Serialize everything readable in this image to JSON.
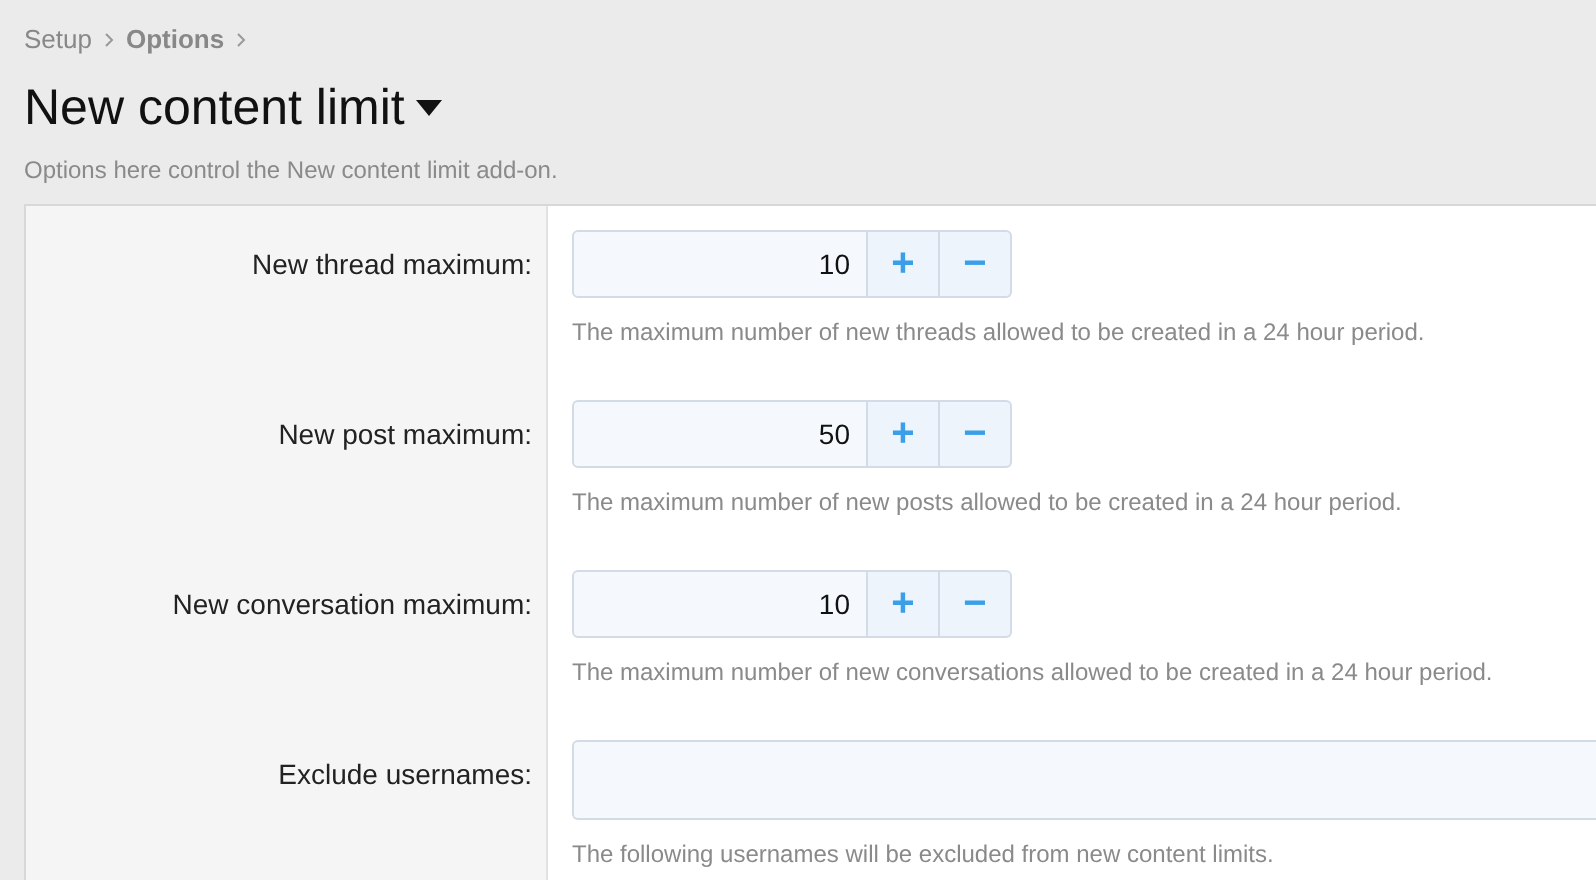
{
  "breadcrumb": [
    "Setup",
    "Options"
  ],
  "title": "New content limit",
  "description": "Options here control the New content limit add-on.",
  "options": [
    {
      "kind": "number",
      "label": "New thread maximum:",
      "value": "10",
      "increment": "+",
      "decrement": "−",
      "hint": "The maximum number of new threads allowed to be created in a 24 hour period."
    },
    {
      "kind": "number",
      "label": "New post maximum:",
      "value": "50",
      "increment": "+",
      "decrement": "−",
      "hint": "The maximum number of new posts allowed to be created in a 24 hour period."
    },
    {
      "kind": "number",
      "label": "New conversation maximum:",
      "value": "10",
      "increment": "+",
      "decrement": "−",
      "hint": "The maximum number of new conversations allowed to be created in a 24 hour period."
    },
    {
      "kind": "text",
      "label": "Exclude usernames:",
      "hint": "The following usernames will be excluded from new content limits."
    }
  ]
}
